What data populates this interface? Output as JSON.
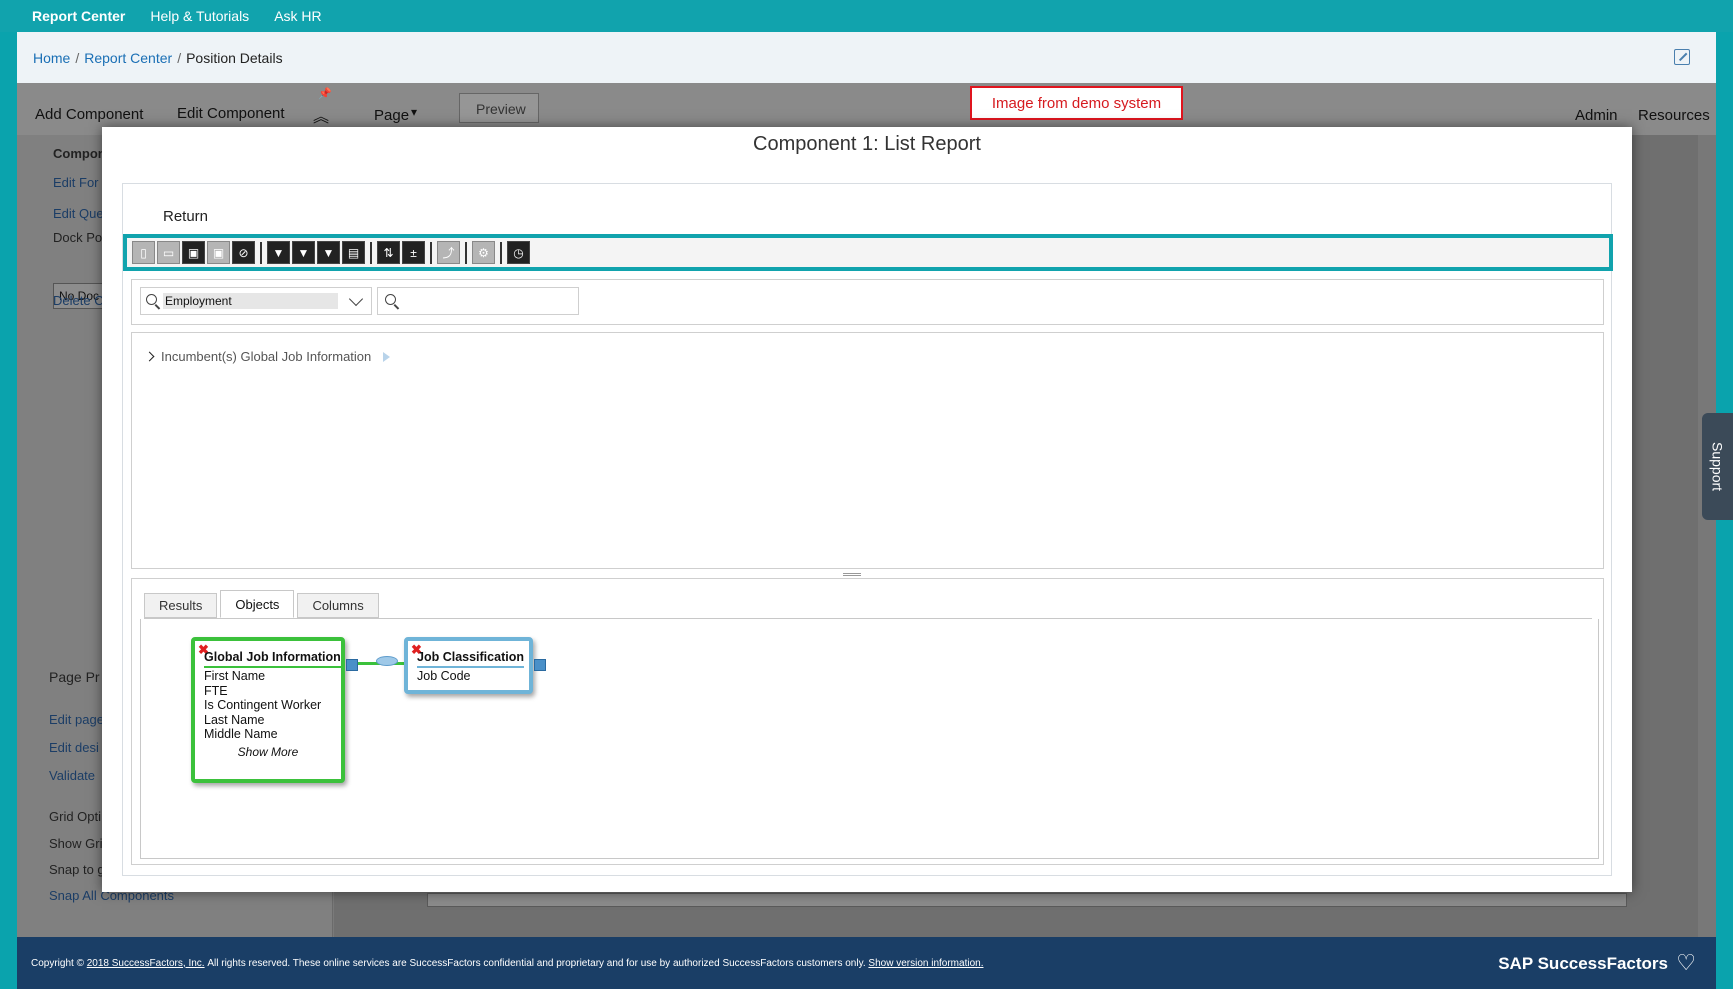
{
  "topnav": {
    "items": [
      "Report Center",
      "Help & Tutorials",
      "Ask HR"
    ]
  },
  "breadcrumb": {
    "home": "Home",
    "report_center": "Report Center",
    "current": "Position Details",
    "separator": "/"
  },
  "background": {
    "toolbar": {
      "add_component": "Add Component",
      "edit_component": "Edit Component",
      "page": "Page",
      "preview": "Preview",
      "admin": "Admin",
      "resources": "Resources"
    },
    "sidebar": {
      "component": "Compon",
      "edit_format": "Edit For",
      "edit_query": "Edit Que",
      "dock_position": "Dock Po",
      "dock_value": "No Doc",
      "delete": "Delete C",
      "page_properties": "Page Pr",
      "edit_page": "Edit page",
      "edit_design": "Edit desi",
      "validate": "Validate",
      "grid_options": "Grid Opti",
      "show_grid": "Show Gri",
      "snap_to_grid": "Snap to g",
      "snap_all": "Snap All Components"
    }
  },
  "demo_label": "Image from demo system",
  "support": "Support",
  "modal": {
    "title": "Component 1: List Report",
    "return_label": "Return",
    "search": {
      "combo_value": "Employment",
      "placeholder": ""
    },
    "tree": {
      "item": "Incumbent(s) Global Job Information"
    },
    "tabs": [
      "Results",
      "Objects",
      "Columns"
    ],
    "active_tab": "Objects",
    "objects": [
      {
        "title": "Global Job Information",
        "fields": [
          "First Name",
          "FTE",
          "Is Contingent Worker",
          "Last Name",
          "Middle Name"
        ],
        "more": "Show More",
        "color": "#3bc13b"
      },
      {
        "title": "Job Classification",
        "fields": [
          "Job Code"
        ],
        "color": "#6fb4d8"
      }
    ]
  },
  "footer": {
    "copyright_prefix": "Copyright ©",
    "company_link": "2018 SuccessFactors, Inc.",
    "text": "All rights reserved. These online services are SuccessFactors confidential and proprietary and for use by authorized SuccessFactors customers only.",
    "version_link": "Show version information.",
    "brand": "SAP SuccessFactors"
  },
  "colors": {
    "teal": "#11a3ad",
    "footer_navy": "#1a3e66",
    "link_blue": "#1a6fb5",
    "demo_red": "#e0141e"
  }
}
